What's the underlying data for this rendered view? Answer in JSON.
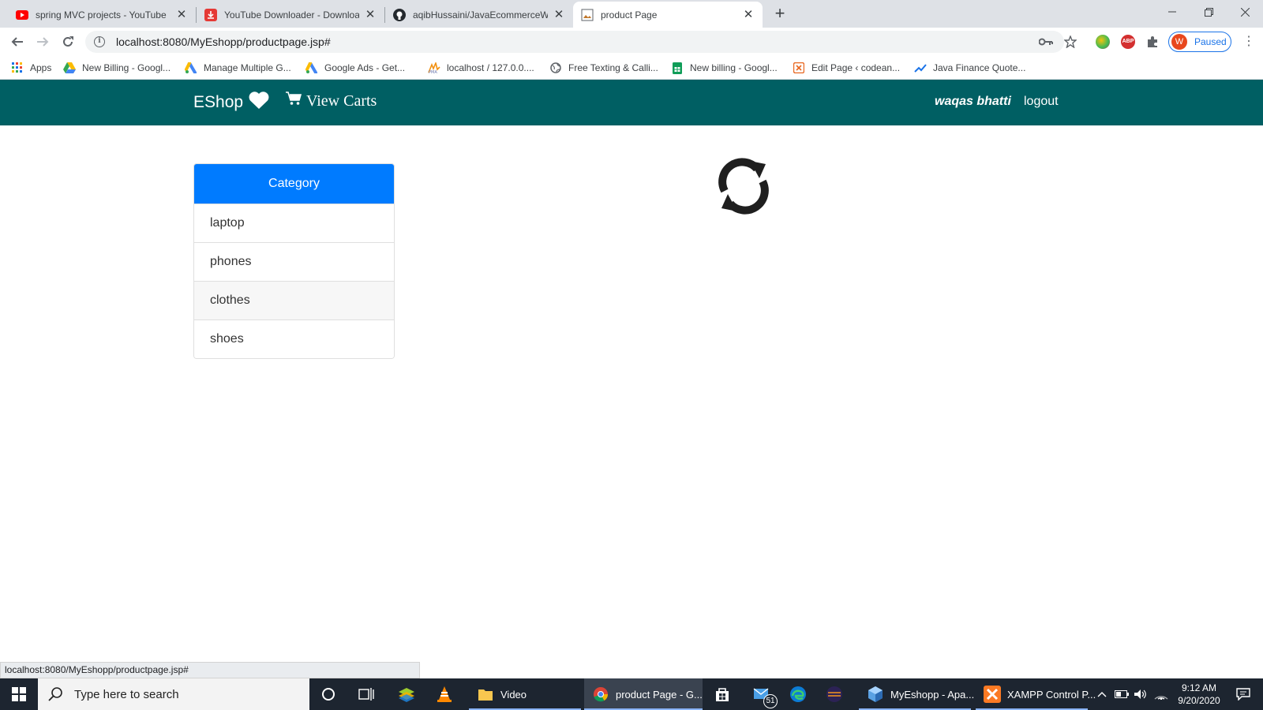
{
  "browser": {
    "tabs": [
      {
        "title": "spring MVC projects - YouTube",
        "icon": "youtube-icon"
      },
      {
        "title": "YouTube Downloader - Downloa",
        "icon": "download-icon"
      },
      {
        "title": "aqibHussaini/JavaEcommerceWe",
        "icon": "github-icon"
      },
      {
        "title": "product Page",
        "icon": "page-icon"
      }
    ],
    "url": "localhost:8080/MyEshopp/productpage.jsp#",
    "profile_initial": "W",
    "profile_status": "Paused",
    "bookmarks": [
      {
        "label": "Apps",
        "icon": "apps-grid-icon"
      },
      {
        "label": "New Billing - Googl...",
        "icon": "google-drive-icon"
      },
      {
        "label": "Manage Multiple G...",
        "icon": "google-ads-icon"
      },
      {
        "label": "Google Ads - Get...",
        "icon": "google-ads-icon"
      },
      {
        "label": "localhost / 127.0.0....",
        "icon": "phpmyadmin-icon"
      },
      {
        "label": "Free Texting & Calli...",
        "icon": "globe-icon"
      },
      {
        "label": "New billing - Googl...",
        "icon": "google-sheets-icon"
      },
      {
        "label": "Edit Page ‹ codean...",
        "icon": "codeanywhere-icon"
      },
      {
        "label": "Java Finance Quote...",
        "icon": "chart-trend-icon"
      }
    ],
    "status_url": "localhost:8080/MyEshopp/productpage.jsp#"
  },
  "navbar": {
    "brand": "EShop",
    "view_carts": "View Carts",
    "username": "waqas bhatti",
    "logout": "logout"
  },
  "category": {
    "heading": "Category",
    "items": [
      "laptop",
      "phones",
      "clothes",
      "shoes"
    ]
  },
  "taskbar": {
    "search_placeholder": "Type here to search",
    "apps": [
      {
        "label": "Video",
        "icon": "folder-icon"
      },
      {
        "label": "product Page - G...",
        "icon": "chrome-icon"
      },
      {
        "label": "MyEshopp - Apa...",
        "icon": "netbeans-icon"
      },
      {
        "label": "XAMPP Control P...",
        "icon": "xampp-icon"
      }
    ],
    "mail_badge": "51",
    "time": "9:12 AM",
    "date": "9/20/2020"
  },
  "colors": {
    "navbar": "#005f63",
    "category_header": "#007bff"
  }
}
